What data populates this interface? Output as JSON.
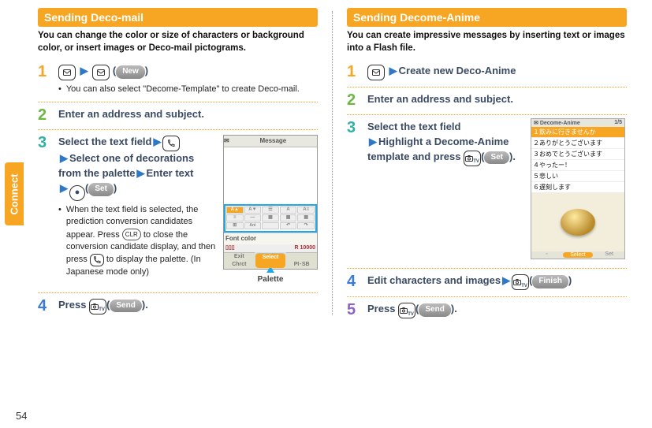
{
  "sidetab": "Connect",
  "pageNumber": "54",
  "left": {
    "title": "Sending Deco-mail",
    "intro": "You can change the color or size of characters or background color, or insert images or Deco-mail pictograms.",
    "step1": {
      "softlabel": "New",
      "note": "You can also select \"Decome-Template\" to create Deco-mail."
    },
    "step2": "Enter an address and subject.",
    "step3": {
      "line1a": "Select the text field",
      "line2": "Select one of decorations from the palette",
      "line2b": "Enter text",
      "setLabel": "Set",
      "noteA": "When the text field is selected, the prediction conversion candidates appear. Press ",
      "clr": "CLR",
      "noteB": " to close the conversion candidate display, and then press ",
      "noteC": " to display the palette. (In Japanese mode only)",
      "fig": {
        "title": "Message",
        "fontcolor": "Font color",
        "countR": "R",
        "countN": "10000",
        "softL": "Exit",
        "softL2": "Chrct",
        "softM": "Select",
        "softR": "PI･SB",
        "caption": "Palette"
      }
    },
    "step4": {
      "a": "Press ",
      "send": "Send",
      "b": "."
    }
  },
  "right": {
    "title": "Sending Decome-Anime",
    "intro": "You can create impressive messages by inserting text or images into a Flash file.",
    "step1": "Create new Deco-Anime",
    "step2": "Enter an address and subject.",
    "step3": {
      "line1": "Select the text field",
      "line2": "Highlight a Decome-Anime template and press ",
      "setLabel": "Set",
      "b": ".",
      "fig": {
        "title": "Decome-Anime",
        "page": "1/5",
        "items": [
          "１飲みに行きませんか",
          "２ありがとうございます",
          "３おめでとうございます",
          "４やったー！",
          "５悲しい",
          "６遅刻します"
        ],
        "softM": "Select",
        "softR": "Set"
      }
    },
    "step4": {
      "a": "Edit characters and images",
      "finish": "Finish"
    },
    "step5": {
      "a": "Press ",
      "send": "Send",
      "b": "."
    }
  }
}
